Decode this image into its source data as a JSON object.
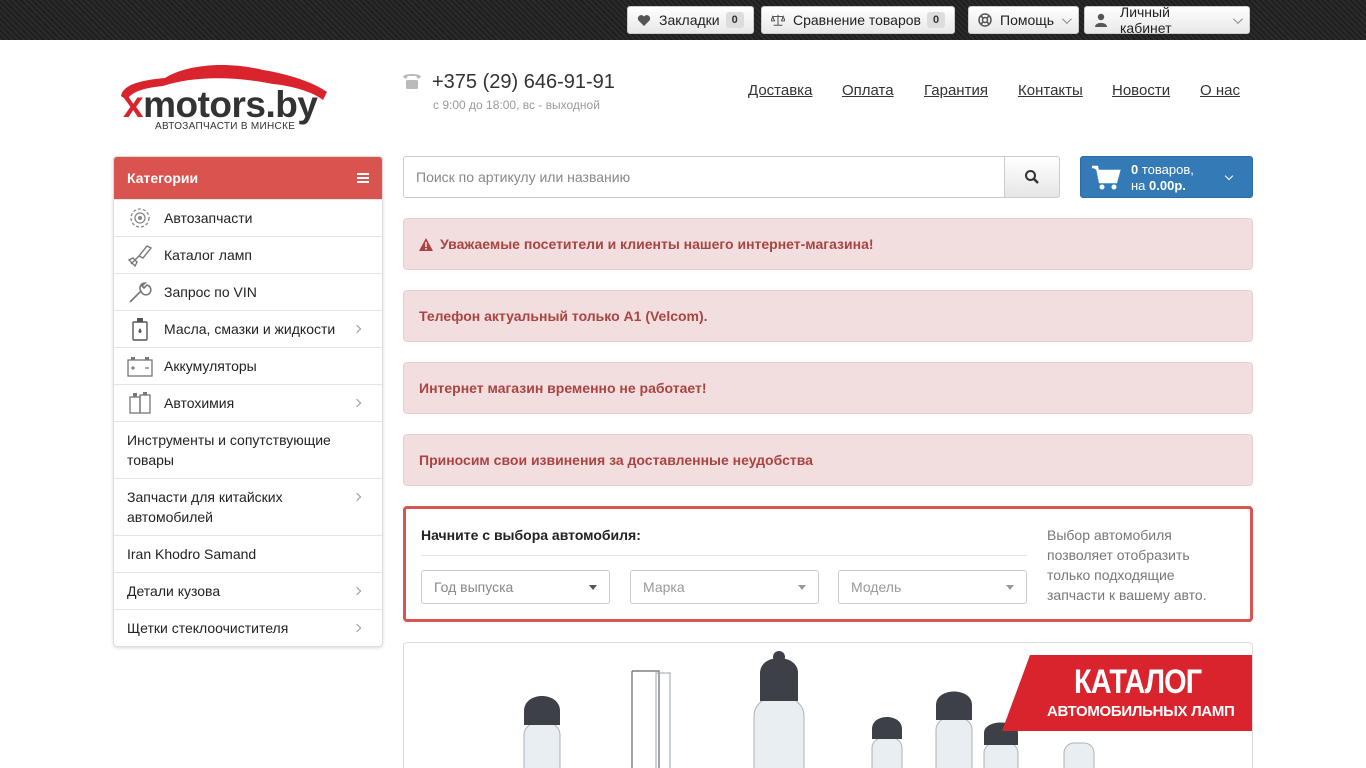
{
  "topbar": {
    "bookmarks_label": "Закладки",
    "bookmarks_count": "0",
    "compare_label": "Сравнение товаров",
    "compare_count": "0",
    "help_label": "Помощь",
    "account_label": "Личный кабинет"
  },
  "logo": {
    "main_x": "x",
    "main_rest": "motors.by",
    "tagline": "АВТОЗАПЧАСТИ В МИНСКЕ"
  },
  "contact": {
    "phone": "+375 (29) 646-91-91",
    "hours": "с 9:00 до 18:00, вс - выходной"
  },
  "nav": [
    "Доставка",
    "Оплата",
    "Гарантия",
    "Контакты",
    "Новости",
    "О нас"
  ],
  "categories": {
    "title": "Категории",
    "items": [
      {
        "label": "Автозапчасти",
        "icon": "gear-icon"
      },
      {
        "label": "Каталог ламп",
        "icon": "lamp-icon"
      },
      {
        "label": "Запрос по VIN",
        "icon": "wrench-icon"
      },
      {
        "label": "Масла, смазки и жидкости",
        "icon": "oil-can-icon"
      },
      {
        "label": "Аккумуляторы",
        "icon": "battery-icon"
      },
      {
        "label": "Автохимия",
        "icon": "chemicals-icon"
      },
      {
        "label": "Инструменты и сопутствующие товары"
      },
      {
        "label": "Запчасти для китайских автомобилей"
      },
      {
        "label": "Iran Khodro Samand"
      },
      {
        "label": "Детали кузова"
      },
      {
        "label": "Щетки стеклоочистителя"
      }
    ]
  },
  "search": {
    "placeholder": "Поиск по артикулу или названию"
  },
  "cart": {
    "count": "0",
    "count_suffix": " товаров,",
    "total_prefix": "на ",
    "total": "0.00р."
  },
  "alerts": [
    "Уважаемые посетители и клиенты нашего интернет-магазина!",
    "Телефон актуальный только А1 (Velcom).",
    "Интернет магазин временно не работает!",
    "Приносим свои извинения за доставленные неудобства"
  ],
  "car_selector": {
    "title": "Начните с выбора автомобиля:",
    "year_placeholder": "Год выпуска",
    "make_placeholder": "Марка",
    "model_placeholder": "Модель",
    "info": "Выбор автомобиля позволяет отобразить только подходящие запчасти к вашему авто."
  },
  "banner": {
    "title": "КАТАЛОГ",
    "subtitle": "АВТОМОБИЛЬНЫХ ЛАМП"
  },
  "colors": {
    "brand_red": "#d9232d",
    "alert_bg": "#f2dede",
    "alert_text": "#a94442",
    "cart_blue": "#337ab7"
  }
}
